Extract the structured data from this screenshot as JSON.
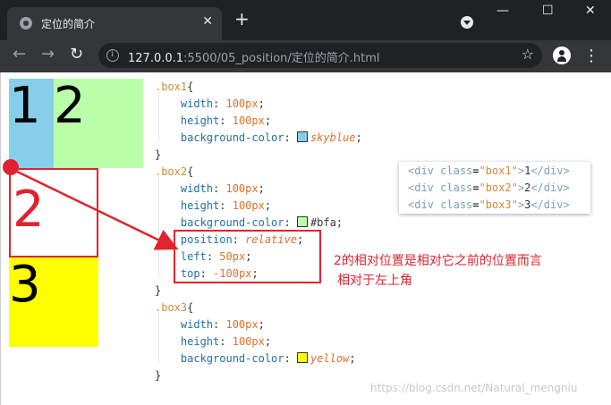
{
  "browser": {
    "tab_title": "定位的简介",
    "close_glyph": "✕",
    "new_tab_glyph": "+",
    "minimize_glyph": "—",
    "maximize_glyph": "☐",
    "window_close_glyph": "✕",
    "back_glyph": "←",
    "forward_glyph": "→",
    "reload_glyph": "↻",
    "url_host": "127.0.0.1",
    "url_path": ":5500/05_position/定位的简介.html",
    "star_glyph": "☆",
    "menu_glyph": "⋮"
  },
  "demo": {
    "box1_label": "1",
    "box2_label": "2",
    "box2_ghost_label": "2",
    "box3_label": "3",
    "colors": {
      "box1": "#87ceeb",
      "box2": "#bbffaa",
      "box3": "#ffff00",
      "annotation": "#e0232e"
    }
  },
  "code": {
    "box1": {
      "selector": ".box1",
      "width_prop": "width",
      "width_val": "100px",
      "height_prop": "height",
      "height_val": "100px",
      "bg_prop": "background-color",
      "bg_val": "skyblue"
    },
    "box2": {
      "selector": ".box2",
      "width_prop": "width",
      "width_val": "100px",
      "height_prop": "height",
      "height_val": "100px",
      "bg_prop": "background-color",
      "bg_val": "#bfa",
      "pos_prop": "position",
      "pos_val": "relative",
      "left_prop": "left",
      "left_val": "50px",
      "top_prop": "top",
      "top_val": "-100px"
    },
    "box3": {
      "selector": ".box3",
      "width_prop": "width",
      "width_val": "100px",
      "height_prop": "height",
      "height_val": "100px",
      "bg_prop": "background-color",
      "bg_val": "yellow"
    },
    "open_brace": "{",
    "close_brace": "}"
  },
  "popup": {
    "lines": [
      {
        "open": "<div",
        "attr": "class",
        "val": "\"box1\"",
        "close1": ">",
        "text": "1",
        "end": "</div>"
      },
      {
        "open": "<div",
        "attr": "class",
        "val": "\"box2\"",
        "close1": ">",
        "text": "2",
        "end": "</div>"
      },
      {
        "open": "<div",
        "attr": "class",
        "val": "\"box3\"",
        "close1": ">",
        "text": "3",
        "end": "</div>"
      }
    ]
  },
  "annotation": {
    "line1": "2的相对位置是相对它之前的位置而言",
    "line2": "相对于左上角"
  },
  "watermark": "https://blog.csdn.net/Natural_mengniu"
}
